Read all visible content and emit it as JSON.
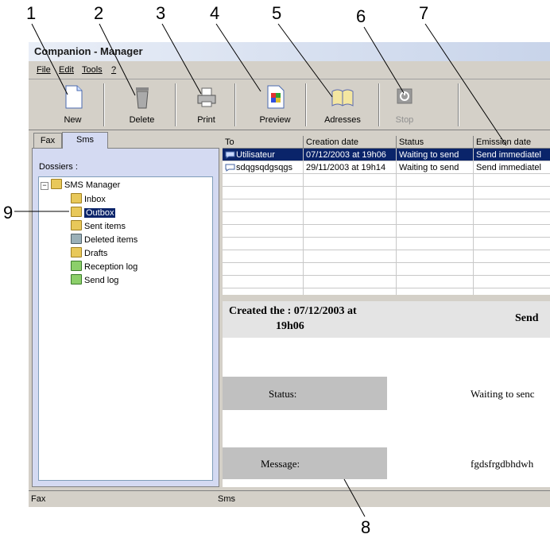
{
  "callouts": [
    "1",
    "2",
    "3",
    "4",
    "5",
    "6",
    "7",
    "8",
    "9"
  ],
  "window": {
    "title": "Companion - Manager"
  },
  "menu": {
    "file": "File",
    "edit": "Edit",
    "tools": "Tools",
    "help": "?"
  },
  "toolbar": {
    "new": "New",
    "delete": "Delete",
    "print": "Print",
    "preview": "Preview",
    "adresses": "Adresses",
    "stop": "Stop"
  },
  "tabs": {
    "fax": "Fax",
    "sms": "Sms"
  },
  "sidebar": {
    "dossiers_label": "Dossiers :",
    "root": "SMS Manager",
    "items": [
      "Inbox",
      "Outbox",
      "Sent items",
      "Deleted items",
      "Drafts",
      "Reception log",
      "Send log"
    ]
  },
  "table": {
    "headers": [
      "To",
      "Creation date",
      "Status",
      "Emission date"
    ],
    "rows": [
      [
        "Utilisateur",
        "07/12/2003 at 19h06",
        "Waiting to send",
        "Send immediatel"
      ],
      [
        "sdqgsqdgsqgs",
        "29/11/2003 at 19h14",
        "Waiting to send",
        "Send immediatel"
      ]
    ]
  },
  "detail": {
    "created": "Created the : 07/12/2003 at",
    "created_time": "19h06",
    "send_title": "Send",
    "status_label": "Status:",
    "status_value": "Waiting to senc",
    "message_label": "Message:",
    "message_value": "fgdsfrgdbhdwh"
  },
  "statusbar": {
    "left": "Fax",
    "right": "Sms"
  }
}
